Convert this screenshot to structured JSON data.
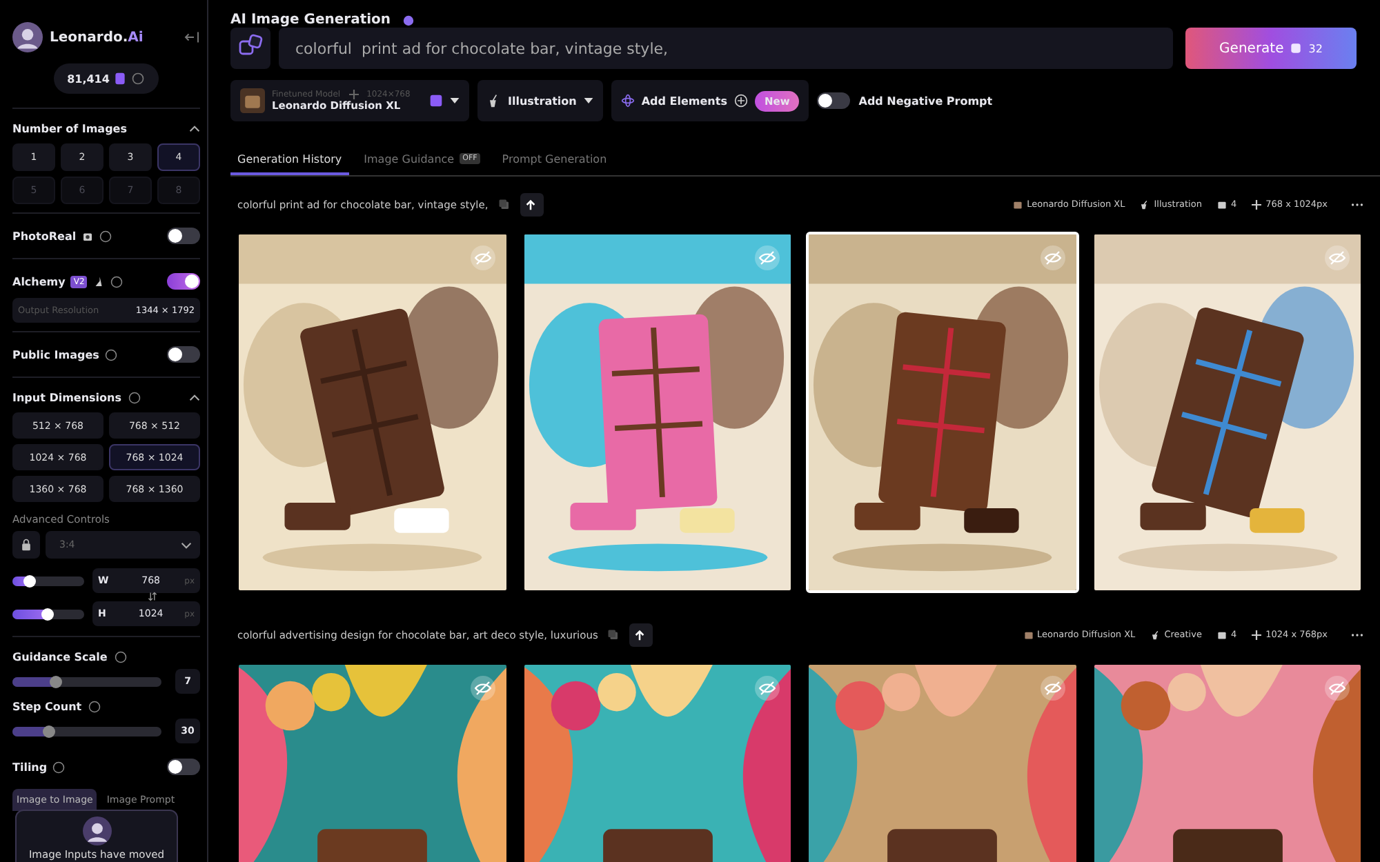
{
  "sidebar": {
    "brand": {
      "name": "Leonardo.",
      "accent": "Ai"
    },
    "tokens": "81,414",
    "number_of_images": {
      "title": "Number of Images",
      "options": [
        {
          "label": "1",
          "selected": false,
          "disabled": false
        },
        {
          "label": "2",
          "selected": false,
          "disabled": false
        },
        {
          "label": "3",
          "selected": false,
          "disabled": false
        },
        {
          "label": "4",
          "selected": true,
          "disabled": false
        },
        {
          "label": "5",
          "selected": false,
          "disabled": true
        },
        {
          "label": "6",
          "selected": false,
          "disabled": true
        },
        {
          "label": "7",
          "selected": false,
          "disabled": true
        },
        {
          "label": "8",
          "selected": false,
          "disabled": true
        }
      ]
    },
    "photoreal": {
      "label": "PhotoReal",
      "on": false
    },
    "alchemy": {
      "label": "Alchemy",
      "badge": "V2",
      "on": true,
      "output_label": "Output Resolution",
      "output_value": "1344 × 1792"
    },
    "public_images": {
      "label": "Public Images",
      "on": false
    },
    "input_dimensions": {
      "title": "Input Dimensions",
      "options": [
        {
          "label": "512 × 768",
          "selected": false
        },
        {
          "label": "768 × 512",
          "selected": false
        },
        {
          "label": "1024 × 768",
          "selected": false
        },
        {
          "label": "768 × 1024",
          "selected": true
        },
        {
          "label": "1360 × 768",
          "selected": false
        },
        {
          "label": "768 × 1360",
          "selected": false
        }
      ]
    },
    "advanced": {
      "title": "Advanced Controls",
      "aspect": "3:4",
      "sizes": [
        {
          "axis": "W",
          "value": "768",
          "unit": "px",
          "level": 0.25
        },
        {
          "axis": "H",
          "value": "1024",
          "unit": "px",
          "level": 0.5
        }
      ]
    },
    "guidance": {
      "label": "Guidance Scale",
      "level": 0.3,
      "value": "7"
    },
    "steps": {
      "label": "Step Count",
      "level": 0.25,
      "value": "30"
    },
    "tiling": {
      "label": "Tiling",
      "on": false
    },
    "image_tabs": [
      {
        "label": "Image to Image",
        "selected": true
      },
      {
        "label": "Image Prompt",
        "selected": false
      }
    ],
    "popup": {
      "text": "Image Inputs have moved"
    }
  },
  "main": {
    "title": "AI Image Generation",
    "prompt": {
      "value": "colorful  print ad for chocolate bar, vintage style,"
    },
    "generate": {
      "label": "Generate",
      "cost": "32"
    },
    "model": {
      "caption": "Finetuned Model",
      "size": "1024×768",
      "name": "Leonardo Diffusion XL"
    },
    "style": {
      "label": "Illustration"
    },
    "elements": {
      "label": "Add Elements",
      "badge": "New"
    },
    "negative": {
      "label": "Add Negative Prompt",
      "on": false
    },
    "tabs": [
      {
        "label": "Generation History",
        "selected": true
      },
      {
        "label": "Image Guidance",
        "badge": "OFF",
        "selected": false
      },
      {
        "label": "Prompt Generation",
        "selected": false
      }
    ],
    "generations": [
      {
        "prompt": "colorful print ad for chocolate bar, vintage style,",
        "model": "Leonardo Diffusion XL",
        "style": "Illustration",
        "count": "4",
        "size": "768 x 1024px",
        "images": [
          {
            "kind": "picture",
            "selected": false
          },
          {
            "kind": "picture",
            "selected": false
          },
          {
            "kind": "picture",
            "selected": true
          },
          {
            "kind": "picture",
            "selected": false
          }
        ]
      },
      {
        "prompt": "colorful advertising design for chocolate bar, art deco style, luxurious",
        "model": "Leonardo Diffusion XL",
        "style": "Creative",
        "count": "4",
        "size": "1024 x 768px",
        "images": [
          {
            "kind": "picture",
            "selected": false
          },
          {
            "kind": "picture",
            "selected": false
          },
          {
            "kind": "picture",
            "selected": false
          },
          {
            "kind": "picture",
            "selected": false
          }
        ]
      }
    ]
  }
}
